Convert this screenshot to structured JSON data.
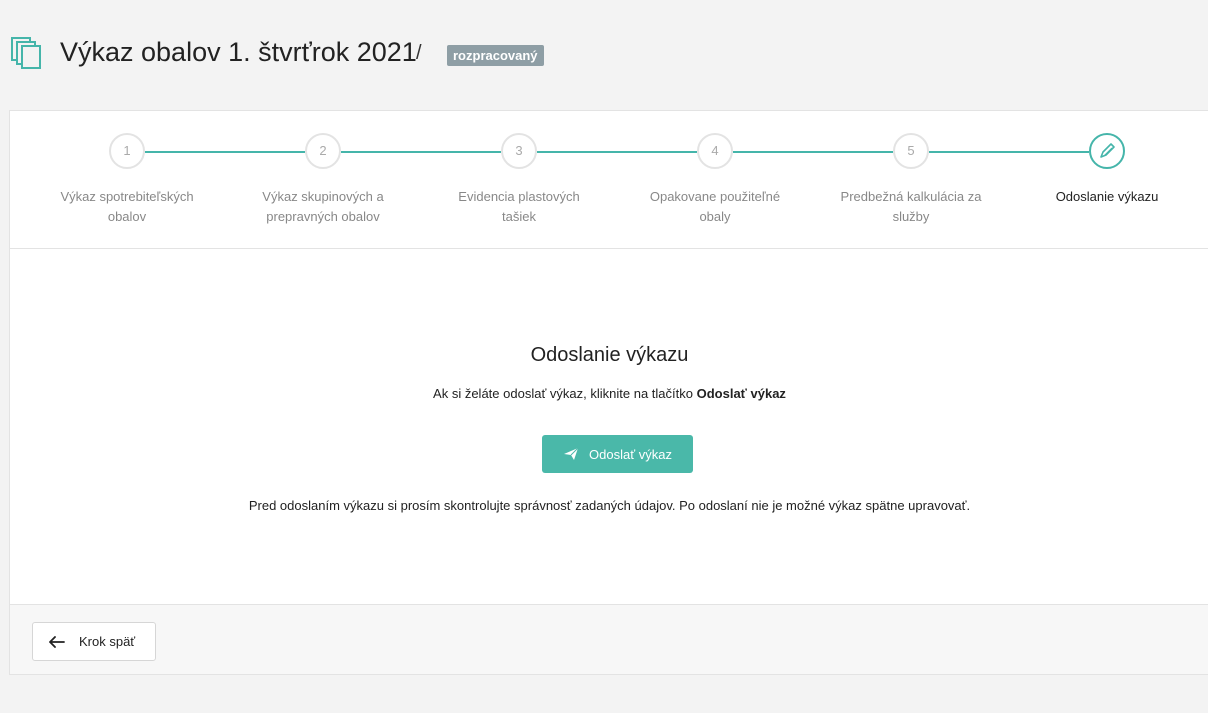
{
  "header": {
    "title": "Výkaz obalov 1. štvrťrok 2021",
    "separator": "/",
    "status_badge": "rozpracovaný",
    "icon": "documents-icon"
  },
  "steps": [
    {
      "number": "1",
      "label_line1": "Výkaz spotrebiteľských",
      "label_line2": "obalov",
      "active": false
    },
    {
      "number": "2",
      "label_line1": "Výkaz skupinových a",
      "label_line2": "prepravných obalov",
      "active": false
    },
    {
      "number": "3",
      "label_line1": "Evidencia plastových",
      "label_line2": "tašiek",
      "active": false
    },
    {
      "number": "4",
      "label_line1": "Opakovane použiteľné",
      "label_line2": "obaly",
      "active": false
    },
    {
      "number": "5",
      "label_line1": "Predbežná kalkulácia za",
      "label_line2": "služby",
      "active": false
    },
    {
      "number": "",
      "icon": "pencil-icon",
      "label_line1": "Odoslanie výkazu",
      "label_line2": "",
      "active": true
    }
  ],
  "main": {
    "title": "Odoslanie výkazu",
    "subtitle_prefix": "Ak si želáte odoslať výkaz, kliknite na tlačítko ",
    "subtitle_bold": "Odoslať výkaz",
    "send_button_label": "Odoslať výkaz",
    "note": "Pred odoslaním výkazu si prosím skontrolujte správnosť zadaných údajov. Po odoslaní nie je možné výkaz spätne upravovať."
  },
  "footer": {
    "back_button_label": "Krok späť"
  },
  "colors": {
    "accent": "#45b5aa",
    "badge": "#8e9ea5"
  }
}
